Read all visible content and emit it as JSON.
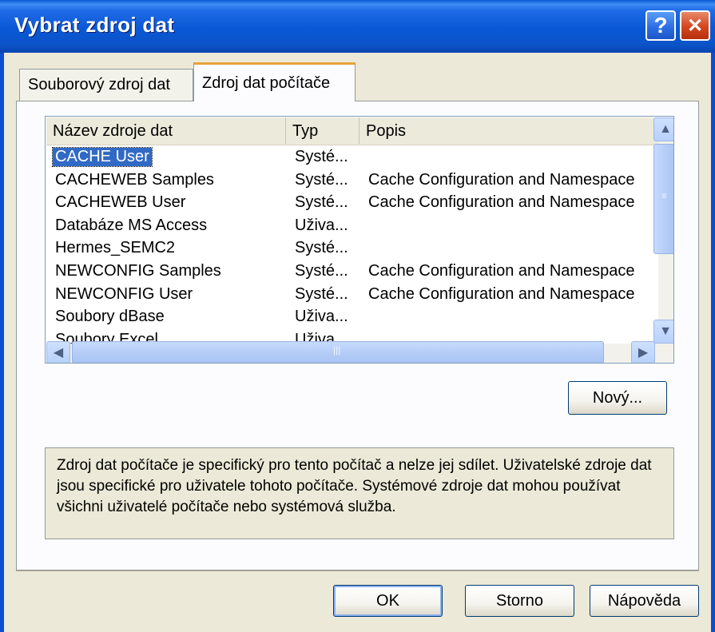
{
  "window": {
    "title": "Vybrat zdroj dat",
    "help_glyph": "?",
    "close_glyph": "✕"
  },
  "tabs": [
    {
      "label": "Souborový zdroj dat",
      "selected": false
    },
    {
      "label": "Zdroj dat počítače",
      "selected": true
    }
  ],
  "list": {
    "columns": [
      "Název zdroje dat",
      "Typ",
      "Popis"
    ],
    "rows": [
      {
        "name": "CACHE User",
        "type": "Systé...",
        "desc": "",
        "selected": true
      },
      {
        "name": "CACHEWEB Samples",
        "type": "Systé...",
        "desc": "Cache Configuration and Namespace"
      },
      {
        "name": "CACHEWEB User",
        "type": "Systé...",
        "desc": "Cache Configuration and Namespace"
      },
      {
        "name": "Databáze MS Access",
        "type": "Uživa...",
        "desc": ""
      },
      {
        "name": "Hermes_SEMC2",
        "type": "Systé...",
        "desc": ""
      },
      {
        "name": "NEWCONFIG Samples",
        "type": "Systé...",
        "desc": "Cache Configuration and Namespace"
      },
      {
        "name": "NEWCONFIG User",
        "type": "Systé...",
        "desc": "Cache Configuration and Namespace"
      },
      {
        "name": "Soubory dBase",
        "type": "Uživa...",
        "desc": ""
      },
      {
        "name": "Soubory Excel",
        "type": "Uživa...",
        "desc": ""
      }
    ]
  },
  "buttons": {
    "new": "Nový...",
    "ok": "OK",
    "cancel": "Storno",
    "help": "Nápověda"
  },
  "info_text": "Zdroj dat počítače je specifický pro tento počítač a nelze jej sdílet. Uživatelské zdroje dat jsou specifické pro uživatele tohoto počítače. Systémové zdroje dat mohou používat všichni uživatelé počítače nebo systémová služba.",
  "icons": {
    "scroll_up": "chevron-up-icon",
    "scroll_down": "chevron-down-icon",
    "scroll_left": "chevron-left-icon",
    "scroll_right": "chevron-right-icon"
  },
  "colors": {
    "titlebar": "#0b57d0",
    "selection": "#316ac5",
    "face": "#ece9d8",
    "tab_highlight": "#e8a33c"
  }
}
